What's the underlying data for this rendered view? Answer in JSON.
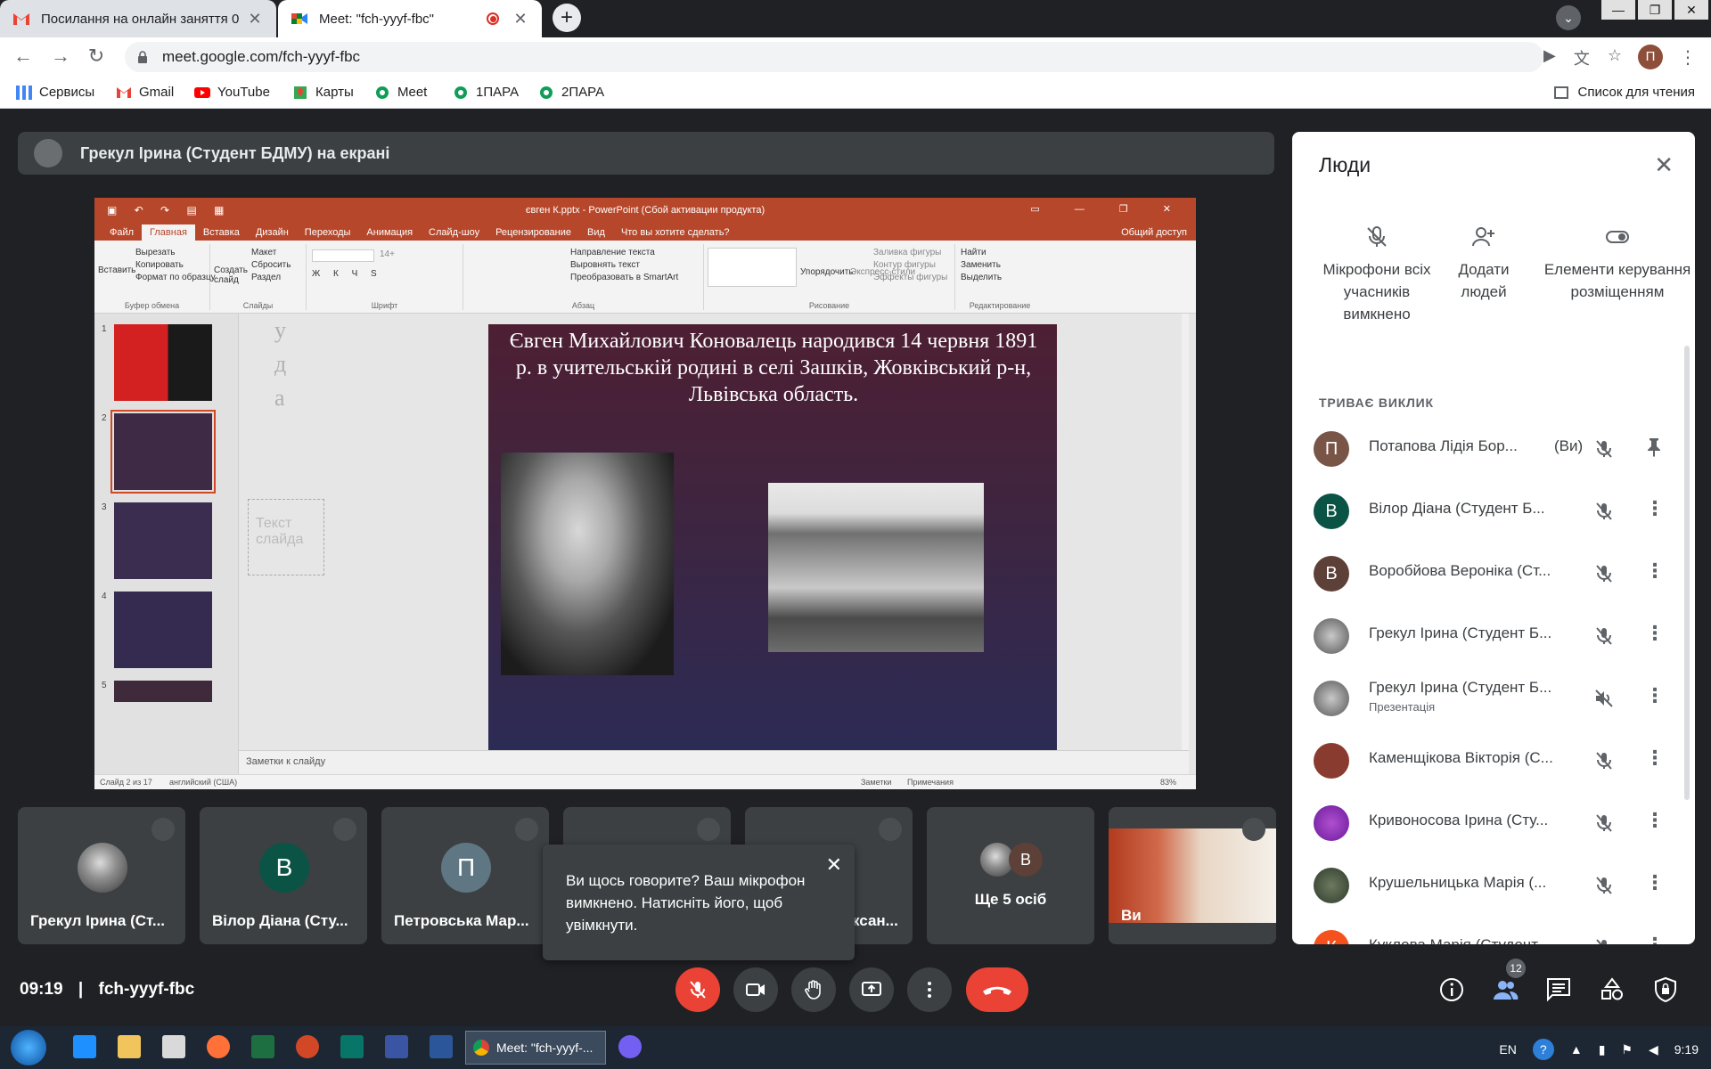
{
  "browser": {
    "tabs": [
      {
        "title": "Посилання на онлайн заняття 0",
        "active": false
      },
      {
        "title": "Meet: \"fch-yyyf-fbc\"",
        "active": true
      }
    ],
    "url": "meet.google.com/fch-yyyf-fbc",
    "profile_letter": "П",
    "bookmarks": [
      "Сервисы",
      "Gmail",
      "YouTube",
      "Карты",
      "Meet",
      "1ПАРА",
      "2ПАРА"
    ],
    "reading_list": "Список для чтения"
  },
  "presenter": {
    "label": "Грекул Ірина (Студент БДМУ) на екрані"
  },
  "powerpoint": {
    "window_title": "євген К.pptx - PowerPoint (Сбой активации продукта)",
    "ribbon_tabs": [
      "Файл",
      "Главная",
      "Вставка",
      "Дизайн",
      "Переходы",
      "Анимация",
      "Слайд-шоу",
      "Рецензирование",
      "Вид"
    ],
    "tell_me": "Что вы хотите сделать?",
    "share": "Общий доступ",
    "ribbon_groups": [
      "Буфер обмена",
      "Слайды",
      "Шрифт",
      "Абзац",
      "Рисование",
      "Редактирование"
    ],
    "ribbon_items": {
      "paste": "Вставить",
      "cut": "Вырезать",
      "copy": "Копировать",
      "format_painter": "Формат по образцу",
      "new_slide": "Создать слайд",
      "layout": "Макет",
      "reset": "Сбросить",
      "section": "Раздел",
      "font_size": "14+",
      "text_direction": "Направление текста",
      "align_text": "Выровнять текст",
      "smartart": "Преобразовать в SmartArt",
      "arrange": "Упорядочить",
      "quick_styles": "Экспресс-стили",
      "shape_fill": "Заливка фигуры",
      "shape_outline": "Контур фигуры",
      "shape_effects": "Эффекты фигуры",
      "find": "Найти",
      "replace": "Заменить",
      "select": "Выделить"
    },
    "slide_text": "Євген Михайлович Коновалець народився 14 червня 1891 р. в учительській родині в селі Зашків, Жовківський р-н, Львівська область.",
    "thumbnail_numbers": [
      "1",
      "2",
      "3",
      "4",
      "5"
    ],
    "ghost_letters": [
      "у",
      "д",
      "а"
    ],
    "ghost_placeholder": "Текст слайда",
    "notes_placeholder": "Заметки к слайду",
    "status": {
      "slide": "Слайд 2 из 17",
      "language": "английский (США)",
      "notes": "Заметки",
      "comments": "Примечания",
      "zoom": "83%"
    }
  },
  "tiles": [
    {
      "name": "Грекул Ірина (Ст...",
      "avatar": "",
      "color": ""
    },
    {
      "name": "Вілор Діана (Сту...",
      "avatar": "В",
      "color": "#0b5345"
    },
    {
      "name": "Петровська Мар...",
      "avatar": "П",
      "color": "#5f7683"
    },
    {
      "name": "",
      "avatar": "",
      "color": ""
    },
    {
      "name": "ксан...",
      "avatar": "",
      "color": ""
    },
    {
      "name": "Ще 5 осіб",
      "avatar": "В",
      "color": "#5d4037"
    },
    {
      "name": "Ви",
      "avatar": "",
      "color": ""
    }
  ],
  "toast": {
    "message": "Ви щось говорите? Ваш мікрофон вимкнено. Натисніть його, щоб увімкнути."
  },
  "people_panel": {
    "title": "Люди",
    "actions": [
      "Мікрофони всіх учасників вимкнено",
      "Додати людей",
      "Елементи керування розміщенням"
    ],
    "section": "ТРИВАЄ ВИКЛИК",
    "participants": [
      {
        "name": "Потапова Лідія Бор...",
        "suffix": "(Ви)",
        "sub": "",
        "avatar": "П",
        "color": "#795548"
      },
      {
        "name": "Вілор Діана (Студент Б...",
        "suffix": "",
        "sub": "",
        "avatar": "В",
        "color": "#0b5345"
      },
      {
        "name": "Воробйова Вероніка (Ст...",
        "suffix": "",
        "sub": "",
        "avatar": "В",
        "color": "#5d4037"
      },
      {
        "name": "Грекул Ірина (Студент Б...",
        "suffix": "",
        "sub": "",
        "avatar": "",
        "color": "#7a7a7a"
      },
      {
        "name": "Грекул Ірина (Студент Б...",
        "suffix": "",
        "sub": "Презентація",
        "avatar": "",
        "color": "#7a7a7a"
      },
      {
        "name": "Каменщікова Вікторія (С...",
        "suffix": "",
        "sub": "",
        "avatar": "",
        "color": "#8a3b2f"
      },
      {
        "name": "Кривоносова Ірина (Сту...",
        "suffix": "",
        "sub": "",
        "avatar": "",
        "color": "#8e24aa"
      },
      {
        "name": "Крушельницька Марія (...",
        "suffix": "",
        "sub": "",
        "avatar": "",
        "color": "#3e4a3a"
      },
      {
        "name": "Куклова Марія (Студент ...",
        "suffix": "",
        "sub": "",
        "avatar": "К",
        "color": "#f4511e"
      }
    ]
  },
  "bottom_bar": {
    "time": "09:19",
    "separator": "|",
    "code": "fch-yyyf-fbc",
    "people_count": "12"
  },
  "taskbar": {
    "task_label": "Meet: \"fch-yyyf-...",
    "lang": "EN",
    "clock": "9:19"
  }
}
